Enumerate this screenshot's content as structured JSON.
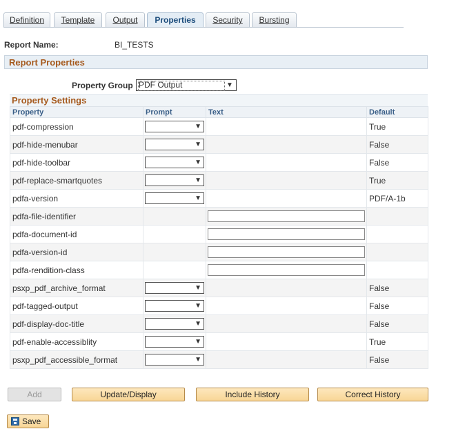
{
  "tabs": [
    {
      "label": "Definition",
      "active": false
    },
    {
      "label": "Template",
      "active": false
    },
    {
      "label": "Output",
      "active": false
    },
    {
      "label": "Properties",
      "active": true
    },
    {
      "label": "Security",
      "active": false
    },
    {
      "label": "Bursting",
      "active": false
    }
  ],
  "report": {
    "name_label": "Report Name:",
    "name_value": "BI_TESTS"
  },
  "section_title": "Report Properties",
  "property_group": {
    "label": "Property Group",
    "value": "PDF Output"
  },
  "grid": {
    "title": "Property Settings",
    "columns": [
      "Property",
      "Prompt",
      "Text",
      "Default"
    ],
    "rows": [
      {
        "property": "pdf-compression",
        "prompt": "",
        "text": null,
        "default": "True"
      },
      {
        "property": "pdf-hide-menubar",
        "prompt": "",
        "text": null,
        "default": "False"
      },
      {
        "property": "pdf-hide-toolbar",
        "prompt": "",
        "text": null,
        "default": "False"
      },
      {
        "property": "pdf-replace-smartquotes",
        "prompt": "",
        "text": null,
        "default": "True"
      },
      {
        "property": "pdfa-version",
        "prompt": "",
        "text": null,
        "default": "PDF/A-1b"
      },
      {
        "property": "pdfa-file-identifier",
        "prompt": null,
        "text": "",
        "default": ""
      },
      {
        "property": "pdfa-document-id",
        "prompt": null,
        "text": "",
        "default": ""
      },
      {
        "property": "pdfa-version-id",
        "prompt": null,
        "text": "",
        "default": ""
      },
      {
        "property": "pdfa-rendition-class",
        "prompt": null,
        "text": "",
        "default": ""
      },
      {
        "property": "psxp_pdf_archive_format",
        "prompt": "",
        "text": null,
        "default": "False"
      },
      {
        "property": "pdf-tagged-output",
        "prompt": "",
        "text": null,
        "default": "False"
      },
      {
        "property": "pdf-display-doc-title",
        "prompt": "",
        "text": null,
        "default": "False"
      },
      {
        "property": "pdf-enable-accessiblity",
        "prompt": "",
        "text": null,
        "default": "True"
      },
      {
        "property": "psxp_pdf_accessible_format",
        "prompt": "",
        "text": null,
        "default": "False"
      }
    ]
  },
  "buttons": {
    "add": "Add",
    "update_display": "Update/Display",
    "include_history": "Include History",
    "correct_history": "Correct History",
    "save": "Save"
  },
  "icons": {
    "dropdown": "chevron-down-icon",
    "save": "floppy-disk-icon"
  },
  "colors": {
    "section_title": "#a65a1e",
    "button_fill": "#f8d696",
    "header_text": "#3a5f88"
  }
}
